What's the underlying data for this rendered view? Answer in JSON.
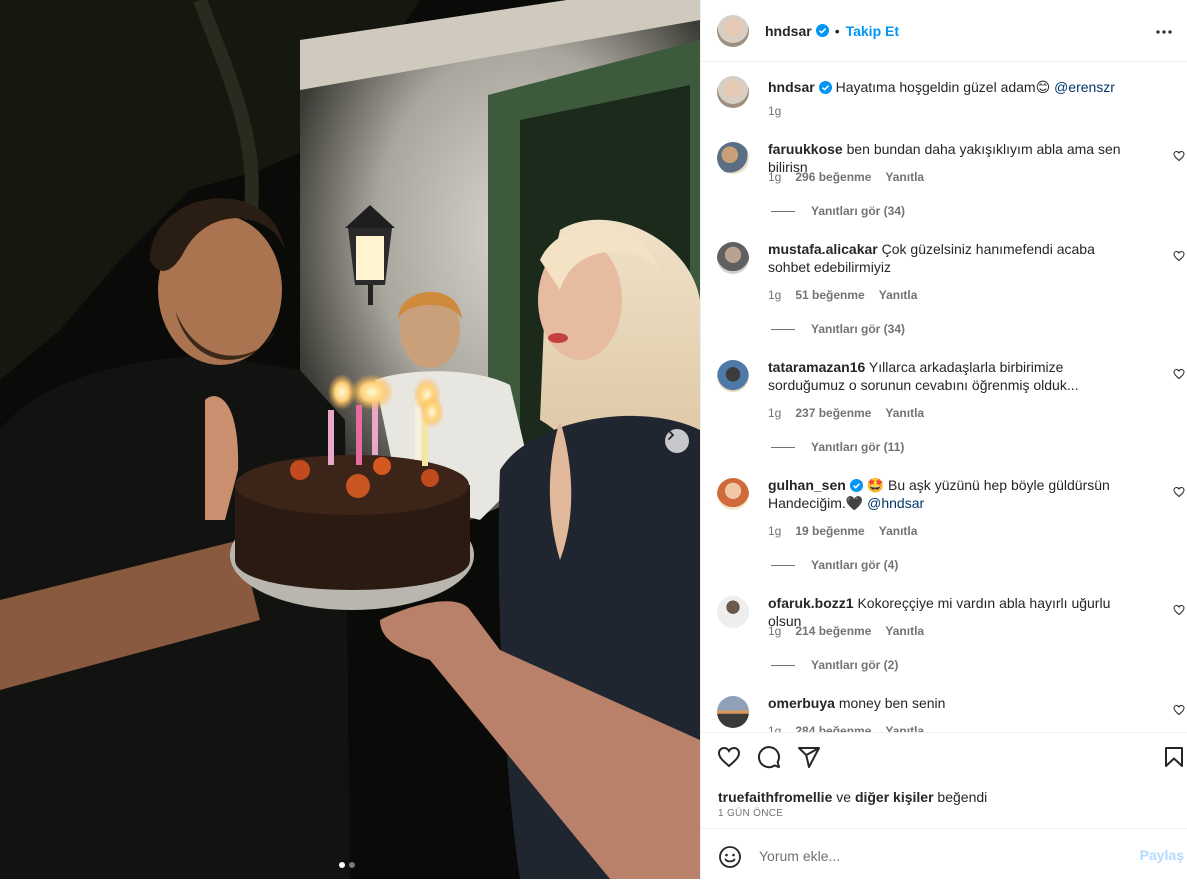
{
  "post": {
    "author": "hndsar",
    "follow_label": "Takip Et",
    "separator": "•",
    "caption_text": "Hayatıma hoşgeldin güzel adam😊",
    "caption_mention": "@erenszr",
    "caption_time": "1g"
  },
  "comments": [
    {
      "user": "faruukkose",
      "text": "ben bundan daha yakışıklıyım abla ama sen bilirisn",
      "time": "1g",
      "likes": "296 beğenme",
      "reply": "Yanıtla",
      "view_replies": "Yanıtları gör (34)",
      "verified": false
    },
    {
      "user": "mustafa.alicakar",
      "text": "Çok güzelsiniz hanımefendi acaba sohbet edebilirmiyiz",
      "time": "1g",
      "likes": "51 beğenme",
      "reply": "Yanıtla",
      "view_replies": "Yanıtları gör (34)",
      "verified": false
    },
    {
      "user": "tataramazan16",
      "text": "Yıllarca arkadaşlarla birbirimize sorduğumuz o sorunun cevabını öğrenmiş olduk...",
      "time": "1g",
      "likes": "237 beğenme",
      "reply": "Yanıtla",
      "view_replies": "Yanıtları gör (11)",
      "verified": false
    },
    {
      "user": "gulhan_sen",
      "text": "🤩 Bu aşk yüzünü hep böyle güldürsün Handeciğim.🖤",
      "mention": "@hndsar",
      "time": "1g",
      "likes": "19 beğenme",
      "reply": "Yanıtla",
      "view_replies": "Yanıtları gör (4)",
      "verified": true
    },
    {
      "user": "ofaruk.bozz1",
      "text": "Kokoreççiye mi vardın abla hayırlı uğurlu olsun",
      "time": "1g",
      "likes": "214 beğenme",
      "reply": "Yanıtla",
      "view_replies": "Yanıtları gör (2)",
      "verified": false
    },
    {
      "user": "omerbuya",
      "text": "money ben senin",
      "time": "1g",
      "likes": "284 beğenme",
      "reply": "Yanıtla",
      "view_replies": "",
      "verified": false
    }
  ],
  "actions": {
    "liked_by_user": "truefaithfromellie",
    "liked_by_and": "ve",
    "liked_by_others": "diğer kişiler",
    "liked_by_suffix": "beğendi",
    "time_ago": "1 GÜN ÖNCE"
  },
  "add_comment": {
    "placeholder": "Yorum ekle...",
    "share_label": "Paylaş"
  },
  "carousel": {
    "slide_count": 2,
    "active_index": 0
  },
  "colors": {
    "link_blue": "#0095f6",
    "verified_blue": "#0095f6",
    "mention": "#00376b",
    "muted": "#737373",
    "share_disabled": "#b3dbff"
  },
  "icons": {
    "verified": "verified-badge-icon",
    "more": "more-horizontal-icon",
    "like": "heart-icon",
    "comment": "comment-bubble-icon",
    "share": "paper-plane-icon",
    "save": "bookmark-icon",
    "emoji": "smiley-icon",
    "next": "chevron-right-icon"
  }
}
